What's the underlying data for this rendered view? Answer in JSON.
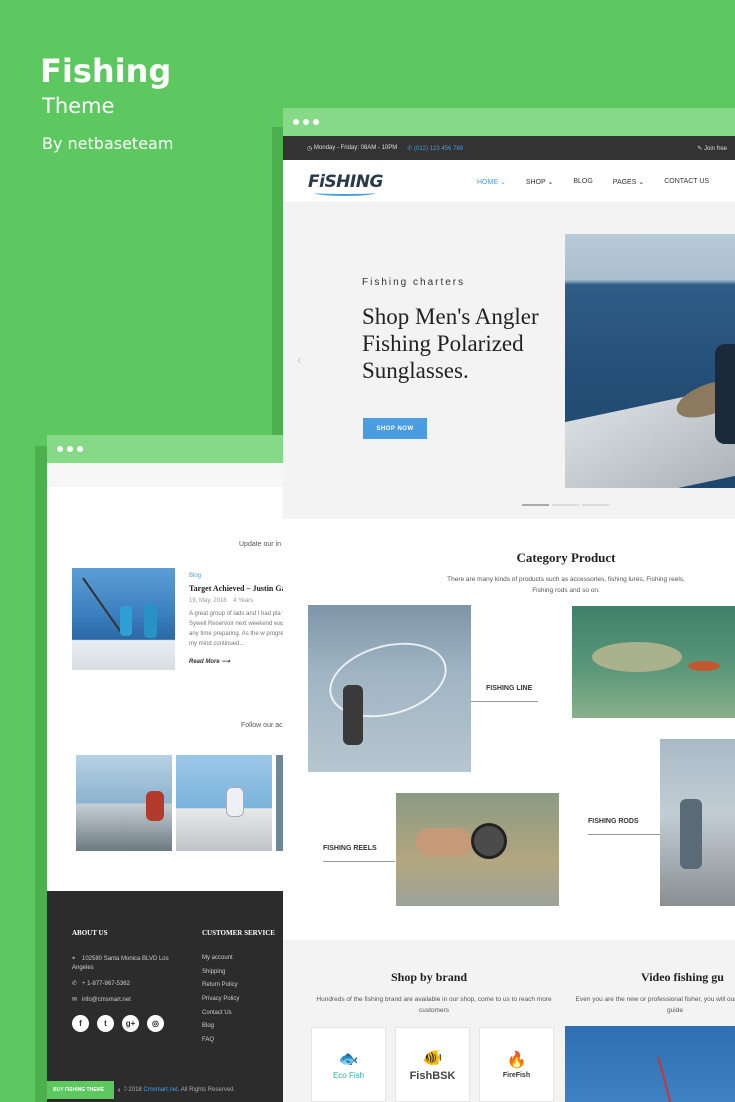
{
  "promo": {
    "title": "Fishing",
    "subtitle": "Theme",
    "byline": "By netbaseteam"
  },
  "back_window": {
    "update_text": "Update our in",
    "blog": {
      "category": "Blog",
      "title": "Target Achieved – Justin Ga",
      "date": "19, May, 2018",
      "age": "4 Years",
      "excerpt": "A great group of lads and I had pla to Sywell Reservoir next weekend waste any time preparing. As the w progressed, my mind continued...",
      "read_more": "Read More"
    },
    "follow_text": "Follow our ac",
    "footer": {
      "about_heading": "ABOUT US",
      "address": "102580 Santa Monica BLVD Los Angeles",
      "phone": "+ 1-877-967-5362",
      "email": "info@cmsmart.net",
      "service_heading": "CUSTOMER SERVICE",
      "service_links": [
        "My account",
        "Shipping",
        "Return Policy",
        "Privacy Policy",
        "Contact Us",
        "Blog",
        "FAQ"
      ],
      "copyright_pre": "t © 2018",
      "copyright_link": "Cmsmart.net",
      "copyright_post": ". All Rights Reserved.",
      "buy_button": "BUY FISHING THEME",
      "socials": [
        "f",
        "t",
        "g+",
        "◎"
      ]
    }
  },
  "front_window": {
    "topbar": {
      "hours": "Monday - Friday: 08AM - 10PM",
      "phone": "(012) 123 456 789",
      "join": "Join free"
    },
    "logo": "FiSHING",
    "nav": [
      {
        "label": "HOME ⌄",
        "active": true
      },
      {
        "label": "SHOP ⌄",
        "active": false
      },
      {
        "label": "BLOG",
        "active": false
      },
      {
        "label": "PAGES ⌄",
        "active": false
      },
      {
        "label": "CONTACT US",
        "active": false
      }
    ],
    "hero": {
      "kicker": "Fishing charters",
      "title": "Shop Men's Angler Fishing Polarized Sunglasses.",
      "button": "SHOP NOW",
      "prev_arrow": "‹"
    },
    "category": {
      "title": "Category Product",
      "description": "There are many kinds of products such as accessories, fishing lures, Fishing reels, Fishing rods and so on.",
      "labels": {
        "line": "FISHING LINE",
        "reels": "FISHING REELS",
        "rods": "FISHING RODS"
      }
    },
    "brands": {
      "title": "Shop by brand",
      "description": "Hundreds of the  fishing brand are available in our shop, come to us to reach more customers",
      "items": [
        {
          "mark": "🐟",
          "name": "Eco Fish"
        },
        {
          "mark": "🐠",
          "name": "FishBSK"
        },
        {
          "mark": "🔥",
          "name": "FireFish"
        }
      ]
    },
    "video": {
      "title": "Video fishing gu",
      "description": "Even you are the new or professional fisher, you will our video fishing guide"
    }
  },
  "colors": {
    "background": "#5cc85f",
    "accent": "#4a9de0",
    "topbar": "#333333",
    "footer": "#2c2c2c"
  }
}
